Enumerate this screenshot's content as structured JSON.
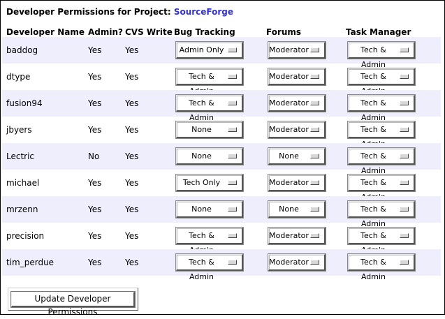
{
  "page": {
    "title_prefix": "Developer Permissions for Project:",
    "project_name": "SourceForge",
    "colors": {
      "project_link": "#3333cc",
      "row_alt": "#eeeefc"
    }
  },
  "table": {
    "headers": {
      "developer": "Developer Name",
      "admin": "Admin?",
      "cvs": "CVS Write",
      "bug": "Bug Tracking",
      "forums": "Forums",
      "task": "Task Manager"
    },
    "rows": [
      {
        "name": "baddog",
        "admin": "Yes",
        "cvs": "Yes",
        "bug": "Admin Only",
        "forums": "Moderator",
        "task": "Tech & Admin"
      },
      {
        "name": "dtype",
        "admin": "Yes",
        "cvs": "Yes",
        "bug": "Tech & Admin",
        "forums": "Moderator",
        "task": "Tech & Admin"
      },
      {
        "name": "fusion94",
        "admin": "Yes",
        "cvs": "Yes",
        "bug": "Tech & Admin",
        "forums": "Moderator",
        "task": "Tech & Admin"
      },
      {
        "name": "jbyers",
        "admin": "Yes",
        "cvs": "Yes",
        "bug": "None",
        "forums": "Moderator",
        "task": "Tech & Admin"
      },
      {
        "name": "Lectric",
        "admin": "No",
        "cvs": "Yes",
        "bug": "None",
        "forums": "None",
        "task": "Tech & Admin"
      },
      {
        "name": "michael",
        "admin": "Yes",
        "cvs": "Yes",
        "bug": "Tech Only",
        "forums": "Moderator",
        "task": "Tech & Admin"
      },
      {
        "name": "mrzenn",
        "admin": "Yes",
        "cvs": "Yes",
        "bug": "None",
        "forums": "None",
        "task": "Tech & Admin"
      },
      {
        "name": "precision",
        "admin": "Yes",
        "cvs": "Yes",
        "bug": "Tech & Admin",
        "forums": "Moderator",
        "task": "Tech & Admin"
      },
      {
        "name": "tim_perdue",
        "admin": "Yes",
        "cvs": "Yes",
        "bug": "Tech & Admin",
        "forums": "Moderator",
        "task": "Tech & Admin"
      }
    ]
  },
  "form": {
    "submit_label": "Update Developer Permissions"
  }
}
